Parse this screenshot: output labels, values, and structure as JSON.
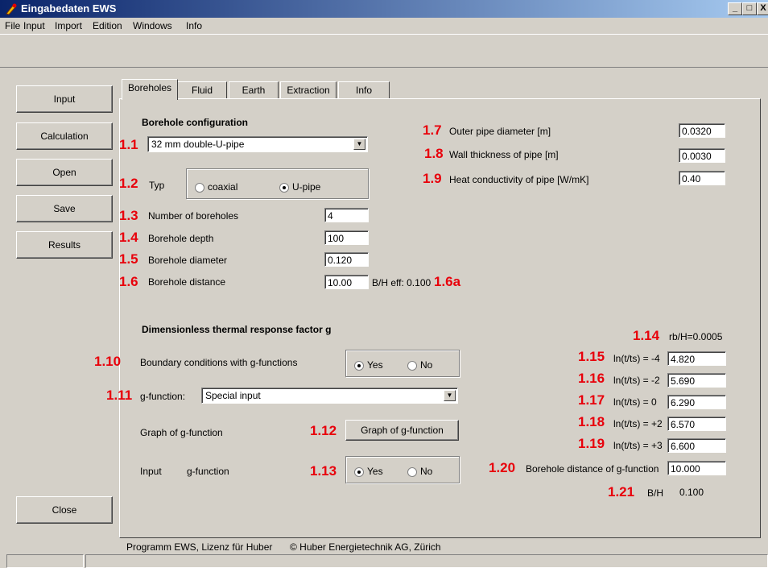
{
  "window": {
    "title": "Eingabedaten EWS",
    "min": "_",
    "max": "□",
    "close": "X"
  },
  "menu": [
    "File",
    "Input",
    "Import",
    "Edition",
    "Windows",
    "Info"
  ],
  "left_buttons": {
    "input": "Input",
    "calculation": "Calculation",
    "open": "Open",
    "save": "Save",
    "results": "Results",
    "close": "Close"
  },
  "tabs": [
    "Boreholes",
    "Fluid",
    "Earth",
    "Extraction",
    "Info"
  ],
  "active_tab": "Boreholes",
  "section1": {
    "title": "Borehole configuration"
  },
  "n": {
    "n1_1": "1.1",
    "n1_2": "1.2",
    "n1_3": "1.3",
    "n1_4": "1.4",
    "n1_5": "1.5",
    "n1_6": "1.6",
    "n1_6a": "1.6a",
    "n1_7": "1.7",
    "n1_8": "1.8",
    "n1_9": "1.9",
    "n1_10": "1.10",
    "n1_11": "1.11",
    "n1_12": "1.12",
    "n1_13": "1.13",
    "n1_14": "1.14",
    "n1_15": "1.15",
    "n1_16": "1.16",
    "n1_17": "1.17",
    "n1_18": "1.18",
    "n1_19": "1.19",
    "n1_20": "1.20",
    "n1_21": "1.21"
  },
  "config_combo": "32 mm double-U-pipe",
  "typ": {
    "label": "Typ",
    "coaxial": "coaxial",
    "upipe": "U-pipe",
    "selected": "U-pipe"
  },
  "fields": {
    "num_boreholes": {
      "label": "Number of boreholes",
      "value": "4"
    },
    "depth": {
      "label": "Borehole depth",
      "value": "100"
    },
    "diameter": {
      "label": "Borehole diameter",
      "value": "0.120"
    },
    "distance": {
      "label": "Borehole distance",
      "value": "10.00"
    },
    "bh_eff": "B/H eff: 0.100",
    "outer_diam": {
      "label": "Outer pipe diameter [m]",
      "value": "0.0320"
    },
    "wall": {
      "label": "Wall thickness of pipe [m]",
      "value": "0.0030"
    },
    "conductivity": {
      "label": "Heat conductivity of pipe [W/mK]",
      "value": "0.40"
    }
  },
  "section2": {
    "title": "Dimensionless thermal response factor g"
  },
  "boundary": {
    "label": "Boundary conditions with g-functions",
    "yes": "Yes",
    "no": "No",
    "selected": "Yes"
  },
  "gfunc": {
    "label": "g-function:",
    "value": "Special input"
  },
  "graph": {
    "label": "Graph of g-function",
    "button": "Graph of g-function"
  },
  "input_g": {
    "label1": "Input",
    "label2": "g-function",
    "yes": "Yes",
    "no": "No",
    "selected": "Yes"
  },
  "rb": "rb/H=0.0005",
  "ln": [
    {
      "label": "ln(t/ts) = -4",
      "value": "4.820"
    },
    {
      "label": "ln(t/ts) = -2",
      "value": "5.690"
    },
    {
      "label": "ln(t/ts) =  0",
      "value": "6.290"
    },
    {
      "label": "ln(t/ts) = +2",
      "value": "6.570"
    },
    {
      "label": "ln(t/ts) = +3",
      "value": "6.600"
    }
  ],
  "bh_distance_g": {
    "label": "Borehole distance of g-function",
    "value": "10.000"
  },
  "bh_ratio": {
    "label": "B/H",
    "value": "0.100"
  },
  "footer": {
    "left": "Programm EWS, Lizenz für Huber",
    "right": "© Huber Energietechnik AG, Zürich"
  }
}
